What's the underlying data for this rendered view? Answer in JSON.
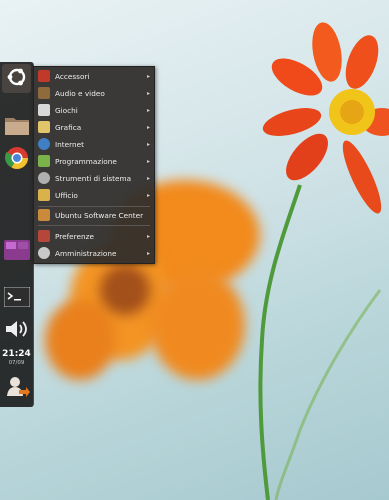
{
  "menu": {
    "items": [
      {
        "label": "Accessori",
        "arrow": "▸",
        "icon": "accessories-icon",
        "color": "#c0392b"
      },
      {
        "label": "Audio e video",
        "arrow": "▸",
        "icon": "audio-video-icon",
        "color": "#8e6a3c"
      },
      {
        "label": "Giochi",
        "arrow": "▸",
        "icon": "games-icon",
        "color": "#d8d8d8"
      },
      {
        "label": "Grafica",
        "arrow": "▸",
        "icon": "graphics-icon",
        "color": "#e2c46a"
      },
      {
        "label": "Internet",
        "arrow": "▸",
        "icon": "internet-icon",
        "color": "#3f7fc4"
      },
      {
        "label": "Programmazione",
        "arrow": "▸",
        "icon": "programming-icon",
        "color": "#7bb34b"
      },
      {
        "label": "Strumenti di sistema",
        "arrow": "▸",
        "icon": "system-tools-icon",
        "color": "#b0b0b0"
      },
      {
        "label": "Ufficio",
        "arrow": "▸",
        "icon": "office-icon",
        "color": "#d9b24c"
      },
      {
        "label": "Ubuntu Software Center",
        "arrow": "",
        "icon": "software-center-icon",
        "color": "#c98b3b"
      },
      {
        "label": "Preferenze",
        "arrow": "▸",
        "icon": "preferences-icon",
        "color": "#b7463a"
      },
      {
        "label": "Amministrazione",
        "arrow": "▸",
        "icon": "administration-icon",
        "color": "#c9c9c9"
      }
    ]
  },
  "launcher": {
    "clock_time": "21:24",
    "clock_date": "07/09"
  }
}
